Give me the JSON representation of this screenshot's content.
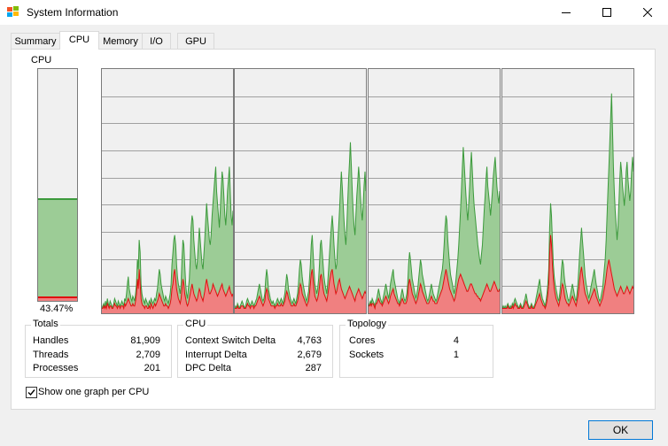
{
  "window": {
    "title": "System Information",
    "icon": "system-info-icon"
  },
  "tabs": [
    {
      "label": "Summary",
      "active": false
    },
    {
      "label": "CPU",
      "active": true
    },
    {
      "label": "Memory",
      "active": false
    },
    {
      "label": "I/O",
      "active": false
    },
    {
      "label": "GPU",
      "active": false
    }
  ],
  "cpu_meter": {
    "label": "CPU",
    "usage_text": "43.47%",
    "usage_fraction": 0.4347,
    "kernel_fraction": 0.01
  },
  "totals": {
    "title": "Totals",
    "rows": [
      {
        "label": "Handles",
        "value": "81,909"
      },
      {
        "label": "Threads",
        "value": "2,709"
      },
      {
        "label": "Processes",
        "value": "201"
      }
    ]
  },
  "cpu_stats": {
    "title": "CPU",
    "rows": [
      {
        "label": "Context Switch Delta",
        "value": "4,763"
      },
      {
        "label": "Interrupt Delta",
        "value": "2,679"
      },
      {
        "label": "DPC Delta",
        "value": "287"
      }
    ]
  },
  "topology": {
    "title": "Topology",
    "rows": [
      {
        "label": "Cores",
        "value": "4"
      },
      {
        "label": "Sockets",
        "value": "1"
      }
    ]
  },
  "show_one_graph": {
    "label": "Show one graph per CPU",
    "checked": true
  },
  "ok_button": {
    "label": "OK"
  },
  "colors": {
    "total_fill": "#9ccc96",
    "total_line": "#3c9a3c",
    "kernel_fill": "#f08080",
    "kernel_line": "#e01010",
    "graph_bg": "#f0f0f0",
    "grid": "#a0a0a0"
  },
  "chart_data": {
    "type": "area",
    "ylim": [
      0,
      100
    ],
    "grid": true,
    "cpus": [
      {
        "total": [
          2,
          3,
          4,
          2,
          5,
          3,
          6,
          4,
          3,
          5,
          4,
          3,
          2,
          4,
          6,
          5,
          4,
          3,
          5,
          4,
          3,
          4,
          5,
          4,
          3,
          6,
          5,
          8,
          12,
          15,
          10,
          8,
          6,
          5,
          7,
          6,
          5,
          8,
          12,
          22,
          18,
          30,
          25,
          12,
          8,
          6,
          5,
          4,
          6,
          5,
          4,
          3,
          5,
          4,
          6,
          5,
          4,
          5,
          6,
          5,
          8,
          10,
          14,
          18,
          16,
          12,
          10,
          8,
          6,
          5,
          7,
          6,
          5,
          4,
          6,
          8,
          12,
          20,
          25,
          30,
          32,
          28,
          20,
          15,
          12,
          10,
          8,
          12,
          22,
          30,
          28,
          20,
          12,
          8,
          6,
          10,
          14,
          22,
          35,
          40,
          38,
          30,
          25,
          20,
          18,
          22,
          28,
          35,
          30,
          25,
          20,
          18,
          24,
          30,
          38,
          45,
          40,
          35,
          30,
          28,
          32,
          40,
          45,
          50,
          55,
          60,
          50,
          45,
          40,
          35,
          42,
          50,
          58,
          55,
          48,
          40,
          36,
          42,
          50,
          55,
          60,
          50,
          40,
          36,
          42
        ],
        "kernel": [
          2,
          2,
          3,
          2,
          3,
          2,
          4,
          3,
          2,
          3,
          3,
          2,
          2,
          3,
          4,
          3,
          3,
          2,
          3,
          3,
          2,
          3,
          3,
          3,
          2,
          4,
          3,
          4,
          5,
          6,
          5,
          4,
          3,
          3,
          4,
          3,
          3,
          5,
          8,
          14,
          10,
          18,
          12,
          6,
          4,
          3,
          3,
          2,
          3,
          3,
          2,
          2,
          3,
          2,
          4,
          3,
          2,
          3,
          4,
          3,
          4,
          5,
          6,
          8,
          7,
          6,
          5,
          4,
          3,
          3,
          4,
          3,
          3,
          2,
          3,
          4,
          6,
          10,
          12,
          16,
          18,
          14,
          10,
          8,
          6,
          5,
          4,
          6,
          10,
          14,
          12,
          8,
          6,
          4,
          3,
          4,
          6,
          8,
          10,
          12,
          10,
          8,
          7,
          6,
          5,
          6,
          8,
          10,
          9,
          7,
          6,
          5,
          7,
          9,
          12,
          14,
          12,
          10,
          8,
          8,
          9,
          10,
          12,
          11,
          10,
          9,
          8,
          7,
          8,
          9,
          10,
          11,
          12,
          10,
          9,
          8,
          7,
          8,
          9,
          10,
          11,
          9,
          8,
          7,
          8
        ]
      },
      {
        "total": [
          2,
          3,
          2,
          4,
          3,
          2,
          3,
          4,
          5,
          4,
          3,
          2,
          3,
          5,
          6,
          5,
          4,
          3,
          4,
          5,
          4,
          3,
          4,
          5,
          6,
          8,
          10,
          12,
          10,
          8,
          6,
          5,
          6,
          8,
          14,
          18,
          15,
          10,
          8,
          6,
          5,
          4,
          5,
          4,
          3,
          4,
          5,
          6,
          5,
          4,
          5,
          6,
          5,
          4,
          6,
          8,
          12,
          16,
          14,
          10,
          8,
          6,
          5,
          4,
          5,
          6,
          5,
          4,
          6,
          8,
          12,
          18,
          22,
          20,
          15,
          12,
          10,
          8,
          6,
          5,
          7,
          9,
          14,
          20,
          28,
          32,
          25,
          18,
          12,
          10,
          8,
          10,
          14,
          20,
          28,
          30,
          25,
          20,
          15,
          12,
          10,
          8,
          12,
          18,
          24,
          30,
          35,
          40,
          35,
          28,
          22,
          18,
          20,
          28,
          35,
          42,
          50,
          58,
          52,
          45,
          38,
          32,
          28,
          35,
          45,
          55,
          62,
          70,
          60,
          50,
          42,
          36,
          32,
          40,
          48,
          54,
          60,
          55,
          48,
          42,
          38,
          44,
          52,
          58,
          50
        ],
        "kernel": [
          2,
          2,
          2,
          3,
          2,
          2,
          2,
          3,
          3,
          3,
          2,
          2,
          2,
          3,
          4,
          3,
          3,
          2,
          3,
          3,
          3,
          2,
          3,
          3,
          4,
          5,
          6,
          7,
          6,
          5,
          4,
          3,
          4,
          5,
          8,
          10,
          9,
          6,
          5,
          4,
          3,
          3,
          3,
          3,
          2,
          3,
          3,
          4,
          3,
          3,
          3,
          4,
          3,
          3,
          4,
          5,
          7,
          9,
          8,
          6,
          5,
          4,
          3,
          3,
          3,
          4,
          3,
          3,
          4,
          5,
          7,
          10,
          12,
          11,
          8,
          7,
          6,
          5,
          4,
          3,
          4,
          5,
          8,
          12,
          16,
          18,
          14,
          10,
          7,
          6,
          5,
          6,
          8,
          11,
          15,
          16,
          13,
          10,
          8,
          7,
          6,
          5,
          7,
          10,
          13,
          15,
          17,
          18,
          15,
          12,
          10,
          8,
          9,
          11,
          13,
          14,
          12,
          10,
          9,
          8,
          7,
          6,
          7,
          8,
          9,
          10,
          11,
          10,
          9,
          8,
          7,
          6,
          5,
          7,
          8,
          9,
          10,
          9,
          8,
          7,
          6,
          7,
          8,
          9,
          8
        ]
      },
      {
        "total": [
          3,
          4,
          5,
          4,
          6,
          5,
          4,
          3,
          5,
          6,
          8,
          10,
          8,
          6,
          5,
          4,
          6,
          8,
          10,
          12,
          10,
          8,
          6,
          8,
          12,
          14,
          16,
          18,
          14,
          12,
          10,
          8,
          6,
          5,
          4,
          6,
          8,
          10,
          8,
          6,
          5,
          6,
          8,
          12,
          20,
          25,
          22,
          18,
          14,
          12,
          10,
          8,
          6,
          8,
          10,
          14,
          18,
          22,
          20,
          16,
          14,
          12,
          10,
          8,
          6,
          5,
          6,
          8,
          10,
          12,
          10,
          8,
          7,
          6,
          5,
          6,
          8,
          10,
          12,
          14,
          16,
          18,
          22,
          28,
          35,
          40,
          38,
          30,
          25,
          20,
          16,
          14,
          12,
          10,
          8,
          10,
          14,
          18,
          22,
          28,
          35,
          42,
          50,
          60,
          68,
          62,
          55,
          48,
          42,
          38,
          45,
          52,
          60,
          66,
          58,
          50,
          44,
          40,
          36,
          32,
          28,
          25,
          22,
          20,
          24,
          28,
          35,
          42,
          48,
          55,
          60,
          52,
          48,
          44,
          40,
          45,
          50,
          56,
          60,
          64,
          58,
          52,
          48,
          45,
          50
        ],
        "kernel": [
          3,
          3,
          4,
          3,
          4,
          4,
          3,
          2,
          4,
          4,
          5,
          6,
          5,
          4,
          4,
          3,
          4,
          5,
          6,
          7,
          6,
          5,
          4,
          5,
          7,
          8,
          9,
          10,
          8,
          7,
          6,
          5,
          4,
          4,
          3,
          4,
          5,
          6,
          5,
          4,
          4,
          4,
          5,
          7,
          12,
          14,
          12,
          10,
          8,
          7,
          6,
          5,
          4,
          5,
          6,
          8,
          10,
          12,
          11,
          9,
          8,
          7,
          6,
          5,
          4,
          4,
          4,
          5,
          6,
          7,
          6,
          5,
          5,
          4,
          4,
          4,
          5,
          6,
          7,
          8,
          9,
          10,
          12,
          14,
          16,
          18,
          16,
          14,
          12,
          10,
          9,
          8,
          7,
          6,
          5,
          6,
          8,
          10,
          12,
          14,
          15,
          16,
          15,
          14,
          13,
          12,
          11,
          10,
          9,
          9,
          10,
          11,
          12,
          12,
          11,
          10,
          9,
          8,
          8,
          7,
          7,
          6,
          6,
          5,
          6,
          7,
          8,
          9,
          10,
          11,
          12,
          11,
          10,
          9,
          9,
          10,
          11,
          12,
          13,
          12,
          11,
          10,
          9,
          9,
          10
        ]
      },
      {
        "total": [
          2,
          3,
          2,
          3,
          2,
          3,
          4,
          3,
          2,
          3,
          2,
          4,
          3,
          5,
          6,
          5,
          4,
          3,
          2,
          3,
          4,
          3,
          2,
          3,
          5,
          6,
          8,
          6,
          4,
          3,
          2,
          3,
          4,
          3,
          2,
          3,
          4,
          6,
          8,
          10,
          12,
          14,
          10,
          8,
          6,
          5,
          4,
          3,
          5,
          8,
          12,
          18,
          35,
          45,
          40,
          30,
          20,
          15,
          12,
          10,
          8,
          6,
          5,
          8,
          12,
          18,
          22,
          20,
          15,
          12,
          10,
          8,
          6,
          5,
          6,
          8,
          10,
          12,
          10,
          8,
          6,
          5,
          8,
          12,
          18,
          25,
          30,
          35,
          30,
          25,
          20,
          15,
          12,
          10,
          8,
          6,
          8,
          10,
          12,
          14,
          16,
          18,
          15,
          12,
          10,
          8,
          6,
          5,
          6,
          8,
          10,
          14,
          18,
          22,
          30,
          40,
          50,
          60,
          70,
          80,
          90,
          75,
          60,
          50,
          42,
          36,
          30,
          35,
          45,
          55,
          62,
          58,
          52,
          48,
          44,
          50,
          58,
          62,
          55,
          50,
          46,
          50,
          58,
          64,
          58
        ],
        "kernel": [
          2,
          2,
          2,
          2,
          2,
          2,
          3,
          2,
          2,
          2,
          2,
          3,
          2,
          3,
          4,
          3,
          3,
          2,
          2,
          2,
          3,
          2,
          2,
          2,
          3,
          4,
          5,
          4,
          3,
          2,
          2,
          2,
          3,
          2,
          2,
          2,
          3,
          4,
          5,
          6,
          7,
          8,
          6,
          5,
          4,
          3,
          3,
          2,
          3,
          5,
          8,
          12,
          24,
          32,
          28,
          20,
          14,
          10,
          8,
          6,
          5,
          4,
          3,
          5,
          7,
          10,
          12,
          11,
          8,
          6,
          5,
          4,
          4,
          3,
          4,
          5,
          6,
          7,
          6,
          5,
          4,
          3,
          5,
          7,
          10,
          14,
          17,
          19,
          16,
          13,
          10,
          8,
          7,
          6,
          5,
          4,
          5,
          6,
          7,
          8,
          9,
          10,
          9,
          7,
          6,
          5,
          4,
          3,
          4,
          5,
          6,
          8,
          10,
          12,
          15,
          18,
          20,
          22,
          20,
          18,
          16,
          14,
          12,
          10,
          9,
          8,
          7,
          8,
          9,
          10,
          11,
          10,
          9,
          8,
          8,
          9,
          10,
          11,
          10,
          9,
          8,
          9,
          10,
          11,
          10
        ]
      }
    ]
  }
}
